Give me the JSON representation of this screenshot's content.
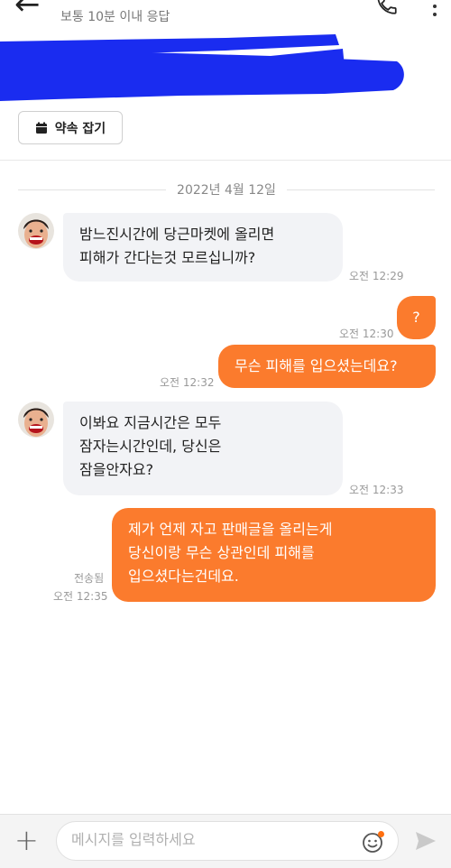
{
  "header": {
    "subtitle": "보통 10분 이내 응답"
  },
  "appointment_button": {
    "label": "약속 잡기",
    "icon": "calendar-icon"
  },
  "date_separator": "2022년 4월 12일",
  "messages": [
    {
      "direction": "in",
      "lines": [
        "밤느진시간에  당근마켓에 올리면",
        "피해가 간다는것 모르십니까?"
      ],
      "time": "오전 12:29"
    },
    {
      "direction": "out",
      "lines": [
        "?"
      ],
      "time": "오전 12:30"
    },
    {
      "direction": "out",
      "lines": [
        "무슨 피해를 입으셨는데요?"
      ],
      "time": "오전 12:32"
    },
    {
      "direction": "in",
      "lines": [
        "이봐요 지금시간은 모두",
        "잠자는시간인데, 당신은",
        "잠을안자요?"
      ],
      "time": "오전 12:33"
    },
    {
      "direction": "out",
      "lines": [
        "제가 언제 자고 판매글을 올리는게",
        "당신이랑 무슨 상관인데 피해를",
        "입으셨다는건데요."
      ],
      "time": "오전 12:35",
      "status": "전송됨"
    }
  ],
  "composer": {
    "placeholder": "메시지를 입력하세요",
    "plus_icon": "plus-icon",
    "emoji_icon": "emoji-icon",
    "send_icon": "send-icon"
  },
  "colors": {
    "outgoing_bubble": "#fb7b2d",
    "incoming_bubble": "#f2f3f6",
    "redaction_scribble": "#1a2cf0",
    "emoji_notification_dot": "#ff6f0f"
  }
}
